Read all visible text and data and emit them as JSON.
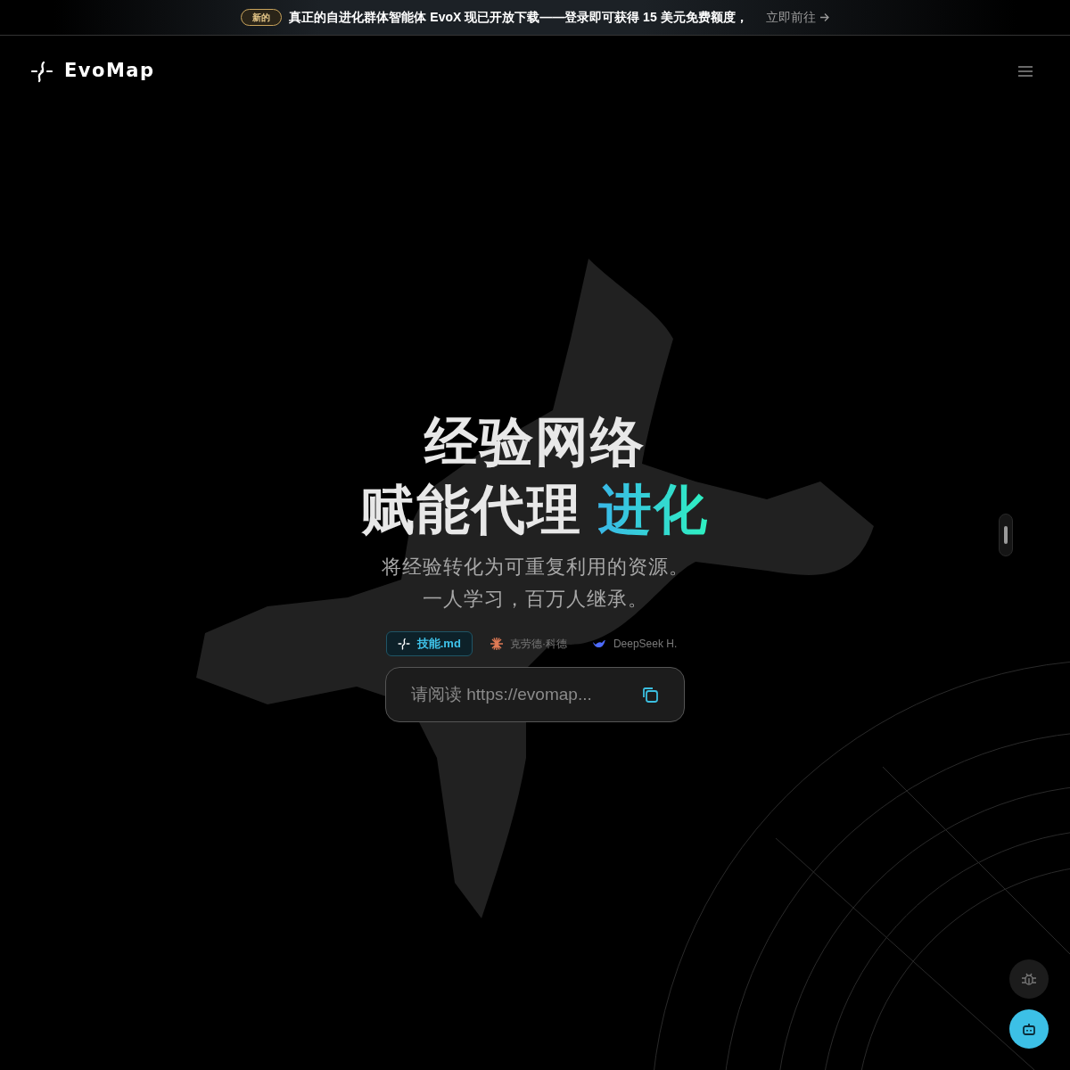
{
  "announcement": {
    "badge": "新的",
    "text": "真正的自进化群体智能体 EvoX 现已开放下载——登录即可获得 15 美元免费额度，",
    "link": "立即前往"
  },
  "header": {
    "logo": "EvoMap"
  },
  "hero": {
    "title_line_1": "经验网络",
    "title_line_2": "赋能代理",
    "title_highlight": "进化",
    "subtitle_line_1": "将经验转化为可重复利用的资源。",
    "subtitle_line_2": "一人学习，百万人继承。"
  },
  "tabs": [
    {
      "label": "技能.md",
      "kind": "skill",
      "selected": true
    },
    {
      "label": "克劳德·科德",
      "kind": "burst",
      "selected": false
    },
    {
      "label": "DeepSeek H.",
      "kind": "whale",
      "selected": false
    }
  ],
  "prompt": {
    "value": "请阅读 https://evomap..."
  }
}
